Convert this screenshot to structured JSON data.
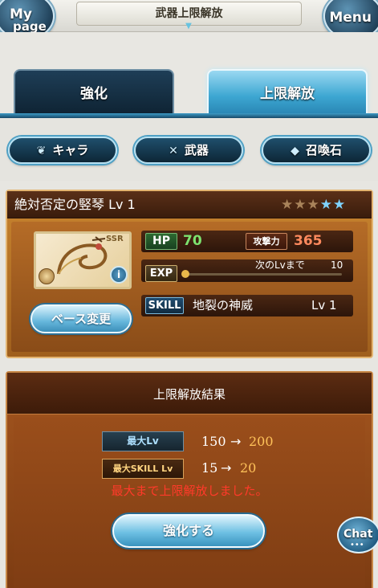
{
  "header": {
    "mypage_line1": "My",
    "mypage_line2": "page",
    "title": "武器上限解放",
    "menu": "Menu"
  },
  "tabs": [
    {
      "label": "強化",
      "active": false
    },
    {
      "label": "上限解放",
      "active": true
    }
  ],
  "filters": [
    {
      "label": "キャラ",
      "icon": "character-icon"
    },
    {
      "label": "武器",
      "icon": "crossed-swords-icon"
    },
    {
      "label": "召喚石",
      "icon": "crystal-icon"
    }
  ],
  "weapon": {
    "name": "絶対否定の竪琴 Lv 1",
    "rarity": "SSR",
    "uncap_stars": {
      "filled": 3,
      "total": 5
    },
    "info": "i",
    "hp_label": "HP",
    "hp": "70",
    "atk_label": "攻撃力",
    "atk": "365",
    "exp_label": "EXP",
    "next_label": "次のLvまで",
    "next_value": "10",
    "exp_progress": 0,
    "skill_label": "SKILL",
    "skill_name": "地裂の神威",
    "skill_lv": "Lv 1",
    "base_change": "ベース変更"
  },
  "result": {
    "title": "上限解放結果",
    "max_lv_label": "最大Lv",
    "max_lv_from": "150",
    "max_lv_to": "200",
    "max_skill_label": "最大SKILL Lv",
    "max_skill_from": "15",
    "max_skill_to": "20",
    "arrow": "→",
    "message": "最大まで上限解放しました。",
    "enhance_button": "強化する"
  },
  "chat": {
    "label": "Chat",
    "dots": "•••"
  },
  "colors": {
    "tab_active": "#3da7d2",
    "tab_inactive": "#0f2434",
    "card": "#b56c27",
    "hp_value": "#7de36f",
    "atk_value": "#ff8a5e",
    "upgraded_value": "#ffc35a",
    "message": "#ff3a2a"
  }
}
